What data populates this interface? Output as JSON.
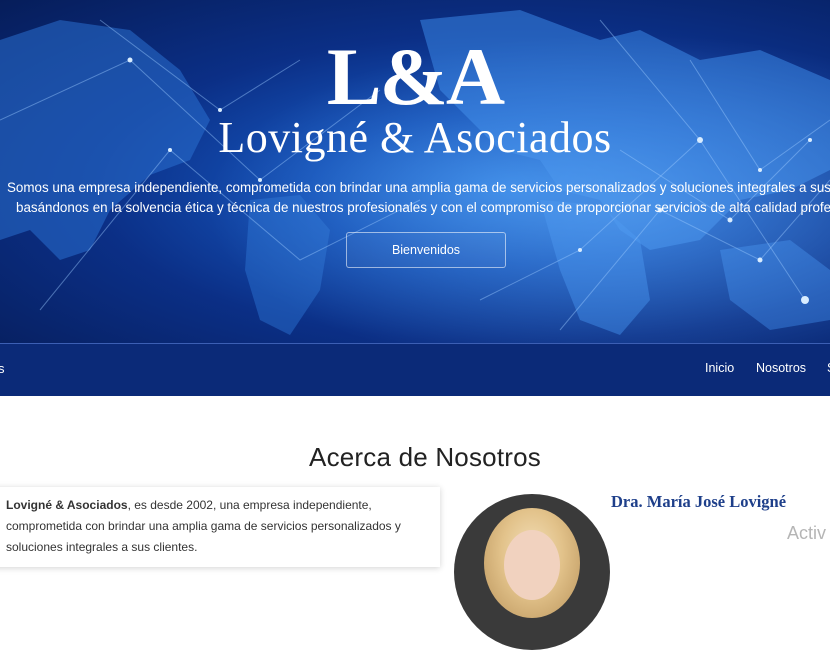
{
  "hero": {
    "logo_mark": "L&A",
    "logo_name": "Lovigné & Asociados",
    "description_line1": "Somos una empresa independiente, comprometida con brindar una amplia gama de servicios personalizados y soluciones integrales a sus clientes,",
    "description_line2": "basándonos en la solvencia ética y técnica de nuestros profesionales y con el compromiso de proporcionar servicios de alta calidad profesional.",
    "cta_label": "Bienvenidos"
  },
  "nav": {
    "brand_fragment": "s",
    "items": [
      {
        "label": "Inicio"
      },
      {
        "label": "Nosotros"
      },
      {
        "label": "S"
      }
    ]
  },
  "about": {
    "title": "Acerca de Nosotros",
    "company_name": "Lovigné & Asociados",
    "text_after_name": ", es desde 2002, una empresa independiente,",
    "text_line2": "comprometida con brindar una amplia gama de servicios personalizados y",
    "text_line3": "soluciones integrales a sus clientes."
  },
  "team": {
    "doctor_name": "Dra. María José Lovigné"
  },
  "overlay": {
    "watermark": "Activ"
  },
  "colors": {
    "hero_dark": "#061d5a",
    "hero_light": "#2f7ee0",
    "navbar": "#0b2a78",
    "doctor_name": "#1e3f8a"
  }
}
